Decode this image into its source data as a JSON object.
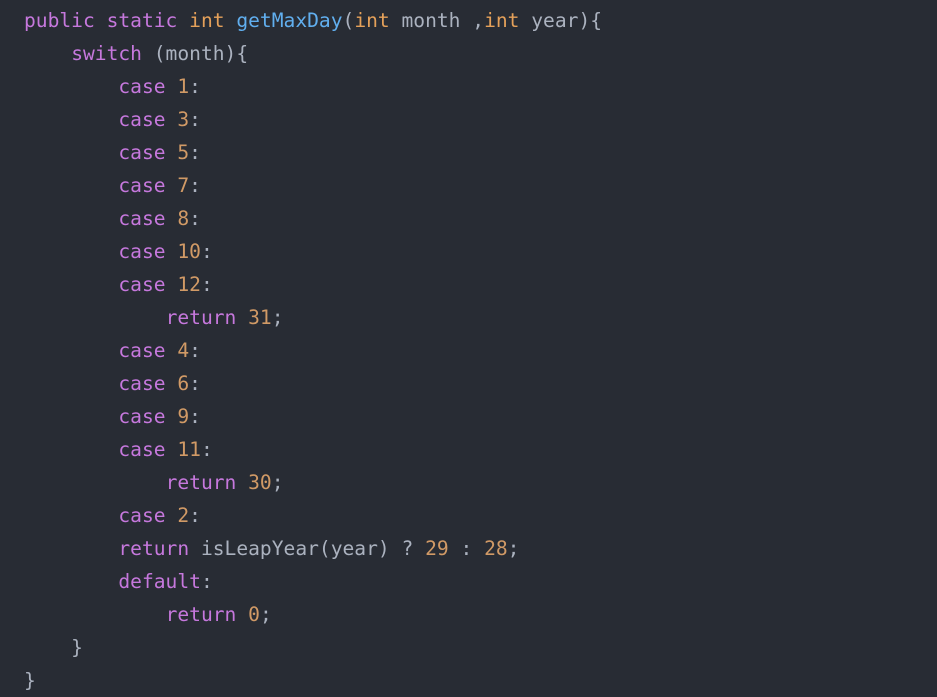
{
  "colors": {
    "background": "#282c34",
    "keyword": "#c678dd",
    "type": "#e5a15a",
    "function": "#61afef",
    "number": "#d19a66",
    "text": "#abb2bf"
  },
  "code": {
    "lines": [
      [
        {
          "t": "public",
          "c": "kw"
        },
        {
          "t": " ",
          "c": "plain"
        },
        {
          "t": "static",
          "c": "kw"
        },
        {
          "t": " ",
          "c": "plain"
        },
        {
          "t": "int",
          "c": "type"
        },
        {
          "t": " ",
          "c": "plain"
        },
        {
          "t": "getMaxDay",
          "c": "fn"
        },
        {
          "t": "(",
          "c": "plain"
        },
        {
          "t": "int",
          "c": "type"
        },
        {
          "t": " month ,",
          "c": "plain"
        },
        {
          "t": "int",
          "c": "type"
        },
        {
          "t": " year){",
          "c": "plain"
        }
      ],
      [
        {
          "t": "    ",
          "c": "plain"
        },
        {
          "t": "switch",
          "c": "kw"
        },
        {
          "t": " (month){",
          "c": "plain"
        }
      ],
      [
        {
          "t": "        ",
          "c": "plain"
        },
        {
          "t": "case",
          "c": "kw"
        },
        {
          "t": " ",
          "c": "plain"
        },
        {
          "t": "1",
          "c": "num"
        },
        {
          "t": ":",
          "c": "plain"
        }
      ],
      [
        {
          "t": "        ",
          "c": "plain"
        },
        {
          "t": "case",
          "c": "kw"
        },
        {
          "t": " ",
          "c": "plain"
        },
        {
          "t": "3",
          "c": "num"
        },
        {
          "t": ":",
          "c": "plain"
        }
      ],
      [
        {
          "t": "        ",
          "c": "plain"
        },
        {
          "t": "case",
          "c": "kw"
        },
        {
          "t": " ",
          "c": "plain"
        },
        {
          "t": "5",
          "c": "num"
        },
        {
          "t": ":",
          "c": "plain"
        }
      ],
      [
        {
          "t": "        ",
          "c": "plain"
        },
        {
          "t": "case",
          "c": "kw"
        },
        {
          "t": " ",
          "c": "plain"
        },
        {
          "t": "7",
          "c": "num"
        },
        {
          "t": ":",
          "c": "plain"
        }
      ],
      [
        {
          "t": "        ",
          "c": "plain"
        },
        {
          "t": "case",
          "c": "kw"
        },
        {
          "t": " ",
          "c": "plain"
        },
        {
          "t": "8",
          "c": "num"
        },
        {
          "t": ":",
          "c": "plain"
        }
      ],
      [
        {
          "t": "        ",
          "c": "plain"
        },
        {
          "t": "case",
          "c": "kw"
        },
        {
          "t": " ",
          "c": "plain"
        },
        {
          "t": "10",
          "c": "num"
        },
        {
          "t": ":",
          "c": "plain"
        }
      ],
      [
        {
          "t": "        ",
          "c": "plain"
        },
        {
          "t": "case",
          "c": "kw"
        },
        {
          "t": " ",
          "c": "plain"
        },
        {
          "t": "12",
          "c": "num"
        },
        {
          "t": ":",
          "c": "plain"
        }
      ],
      [
        {
          "t": "            ",
          "c": "plain"
        },
        {
          "t": "return",
          "c": "kw"
        },
        {
          "t": " ",
          "c": "plain"
        },
        {
          "t": "31",
          "c": "num"
        },
        {
          "t": ";",
          "c": "plain"
        }
      ],
      [
        {
          "t": "        ",
          "c": "plain"
        },
        {
          "t": "case",
          "c": "kw"
        },
        {
          "t": " ",
          "c": "plain"
        },
        {
          "t": "4",
          "c": "num"
        },
        {
          "t": ":",
          "c": "plain"
        }
      ],
      [
        {
          "t": "        ",
          "c": "plain"
        },
        {
          "t": "case",
          "c": "kw"
        },
        {
          "t": " ",
          "c": "plain"
        },
        {
          "t": "6",
          "c": "num"
        },
        {
          "t": ":",
          "c": "plain"
        }
      ],
      [
        {
          "t": "        ",
          "c": "plain"
        },
        {
          "t": "case",
          "c": "kw"
        },
        {
          "t": " ",
          "c": "plain"
        },
        {
          "t": "9",
          "c": "num"
        },
        {
          "t": ":",
          "c": "plain"
        }
      ],
      [
        {
          "t": "        ",
          "c": "plain"
        },
        {
          "t": "case",
          "c": "kw"
        },
        {
          "t": " ",
          "c": "plain"
        },
        {
          "t": "11",
          "c": "num"
        },
        {
          "t": ":",
          "c": "plain"
        }
      ],
      [
        {
          "t": "            ",
          "c": "plain"
        },
        {
          "t": "return",
          "c": "kw"
        },
        {
          "t": " ",
          "c": "plain"
        },
        {
          "t": "30",
          "c": "num"
        },
        {
          "t": ";",
          "c": "plain"
        }
      ],
      [
        {
          "t": "        ",
          "c": "plain"
        },
        {
          "t": "case",
          "c": "kw"
        },
        {
          "t": " ",
          "c": "plain"
        },
        {
          "t": "2",
          "c": "num"
        },
        {
          "t": ":",
          "c": "plain"
        }
      ],
      [
        {
          "t": "        ",
          "c": "plain"
        },
        {
          "t": "return",
          "c": "kw"
        },
        {
          "t": " isLeapYear(year) ? ",
          "c": "plain"
        },
        {
          "t": "29",
          "c": "num"
        },
        {
          "t": " : ",
          "c": "plain"
        },
        {
          "t": "28",
          "c": "num"
        },
        {
          "t": ";",
          "c": "plain"
        }
      ],
      [
        {
          "t": "        ",
          "c": "plain"
        },
        {
          "t": "default",
          "c": "kw"
        },
        {
          "t": ":",
          "c": "plain"
        }
      ],
      [
        {
          "t": "            ",
          "c": "plain"
        },
        {
          "t": "return",
          "c": "kw"
        },
        {
          "t": " ",
          "c": "plain"
        },
        {
          "t": "0",
          "c": "num"
        },
        {
          "t": ";",
          "c": "plain"
        }
      ],
      [
        {
          "t": "    }",
          "c": "plain"
        }
      ],
      [
        {
          "t": "}",
          "c": "plain"
        }
      ]
    ]
  }
}
